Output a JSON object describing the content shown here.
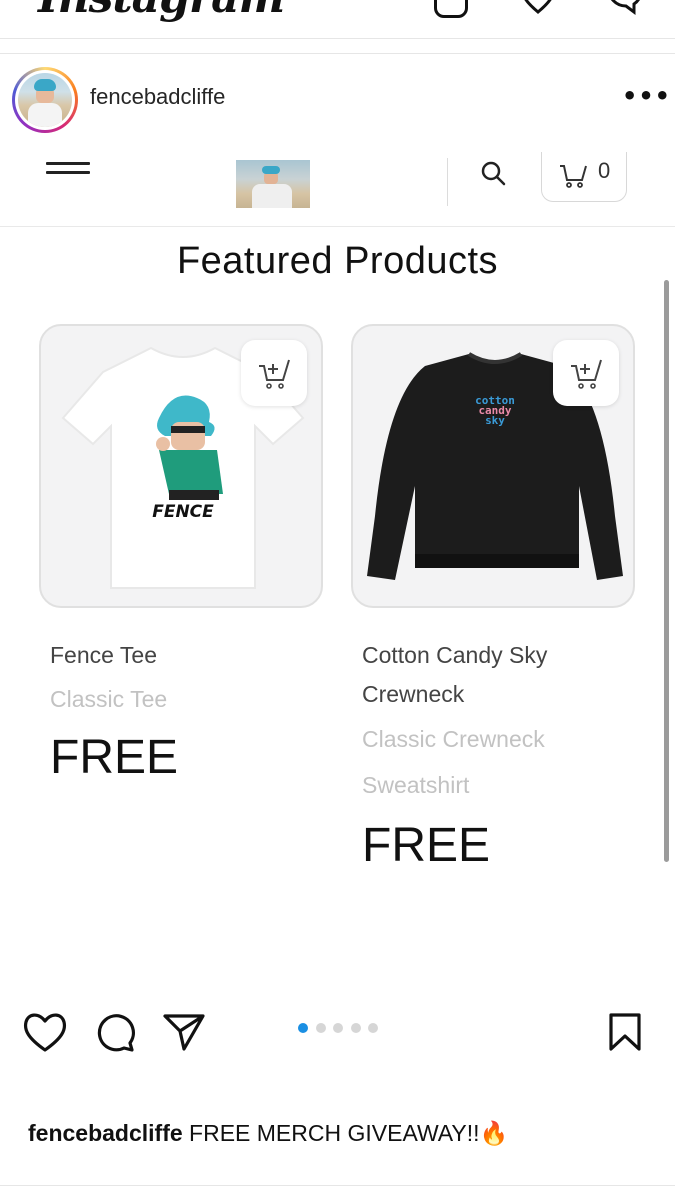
{
  "app": {
    "logo_text": "Instagram"
  },
  "post": {
    "username": "fencebadcliffe",
    "more_label": "•••",
    "caption_username": "fencebadcliffe",
    "caption_text": "FREE MERCH GIVEAWAY!!🔥"
  },
  "shop": {
    "cart_count": "0",
    "section_title": "Featured Products",
    "products": [
      {
        "name": "Fence Tee",
        "type": "Classic Tee",
        "price": "FREE",
        "print_text": "FENCE"
      },
      {
        "name_line1": "Cotton Candy Sky",
        "name_line2": "Crewneck",
        "type_line1": "Classic Crewneck",
        "type_line2": "Sweatshirt",
        "price": "FREE",
        "print_lines": [
          "cotton",
          "candy",
          "sky"
        ]
      }
    ]
  },
  "carousel": {
    "total": 5,
    "active_index": 0
  },
  "colors": {
    "accent": "#1a8fe3",
    "tee_char_hair": "#3fb8c9",
    "print_blue": "#3a9bd8",
    "print_pink": "#e98aa8"
  },
  "icons": [
    "heart-icon",
    "comment-icon",
    "share-icon",
    "bookmark-icon",
    "search-icon",
    "cart-icon",
    "add-to-cart-icon",
    "hamburger-icon",
    "more-icon"
  ]
}
